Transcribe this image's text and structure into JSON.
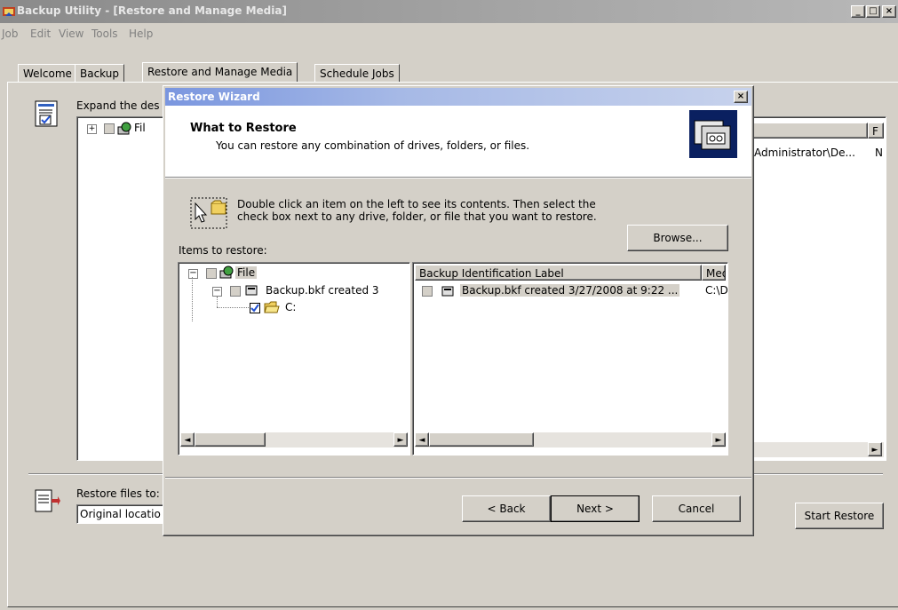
{
  "window": {
    "title": "Backup Utility - [Restore and Manage Media]"
  },
  "menu": [
    "Job",
    "Edit",
    "View",
    "Tools",
    "Help"
  ],
  "tabs": [
    "Welcome",
    "Backup",
    "Restore and Manage Media",
    "Schedule Jobs"
  ],
  "main": {
    "expand_text": "Expand the des",
    "tree_item": "Fil",
    "right_header": "F",
    "right_row_path": "Administrator\\De...",
    "right_row_col2": "N",
    "restore_to_label": "Restore files to:",
    "restore_to_value": "Original locatio",
    "start_restore": "Start Restore"
  },
  "wizard": {
    "title": "Restore Wizard",
    "heading": "What to Restore",
    "subheading": "You can restore any combination of drives, folders, or files.",
    "instructions_line1": "Double click an item on the left to see its contents. Then select the",
    "instructions_line2": "check box next to any drive, folder, or file that you want to restore.",
    "items_label": "Items to restore:",
    "browse": "Browse...",
    "tree": {
      "root": "File",
      "backup": "Backup.bkf created 3",
      "drive": "C:"
    },
    "list": {
      "col1": "Backup Identification Label",
      "col2": "Med",
      "row_label": "Backup.bkf created 3/27/2008 at 9:22 ...",
      "row_media": "C:\\D"
    },
    "back": "< Back",
    "next": "Next >",
    "cancel": "Cancel"
  }
}
